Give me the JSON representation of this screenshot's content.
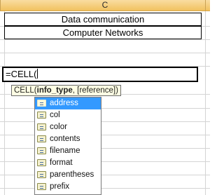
{
  "column_header": {
    "letter": "C"
  },
  "cells": {
    "row1": "Data communication",
    "row2": "Computer Networks",
    "active_formula": "=CELL("
  },
  "tooltip": {
    "function_name": "CELL",
    "open_paren": "(",
    "current_arg": "info_type",
    "separator": ", ",
    "optional_arg": "[reference]",
    "close_paren": ")"
  },
  "autocomplete": {
    "selected_index": 0,
    "items": [
      {
        "label": "address",
        "icon": "function-argument-icon"
      },
      {
        "label": "col",
        "icon": "function-argument-icon"
      },
      {
        "label": "color",
        "icon": "function-argument-icon"
      },
      {
        "label": "contents",
        "icon": "function-argument-icon"
      },
      {
        "label": "filename",
        "icon": "function-argument-icon"
      },
      {
        "label": "format",
        "icon": "function-argument-icon"
      },
      {
        "label": "parentheses",
        "icon": "function-argument-icon"
      },
      {
        "label": "prefix",
        "icon": "function-argument-icon"
      }
    ]
  },
  "colors": {
    "header_gradient_top": "#f9dda1",
    "header_gradient_bottom": "#f1c15f",
    "selection": "#3399ff",
    "tooltip_bg": "#ffffe4"
  }
}
